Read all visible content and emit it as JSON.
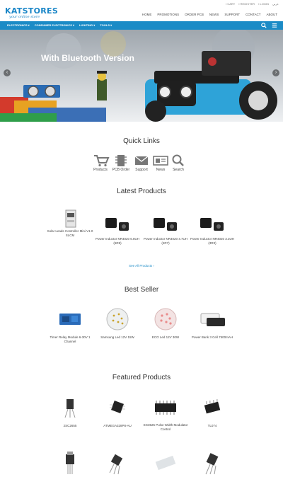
{
  "header": {
    "brand": "KATSTORES",
    "tagline": "your online store",
    "util_links": [
      "CART",
      "REGISTER",
      "LOGIN",
      "عربي"
    ],
    "nav": [
      "HOME",
      "PROMOTIONS",
      "ORDER PCB",
      "NEWS",
      "SUPPORT",
      "CONTACT",
      "ABOUT"
    ]
  },
  "categories": [
    "ELECTRONICS",
    "CONSUMER ELECTRONICS",
    "LIGHTING",
    "TOOLS"
  ],
  "hero": {
    "title": "With Bluetooth Version"
  },
  "quick_links": {
    "title": "Quick Links",
    "items": [
      "Products",
      "PCB Order",
      "Support",
      "News",
      "Search"
    ]
  },
  "latest": {
    "title": "Latest Products",
    "items": [
      "Solar Leads Controller Mini V1.0 SLCM",
      "Power Inductor NR4020 6.8UH (6R8)",
      "Power Inductor NR4020 4.7UH (4R7)",
      "Power Inductor NR4020 3.3UH (3R3)"
    ],
    "see_all": "See All Products"
  },
  "best_seller": {
    "title": "Best Seller",
    "items": [
      "Timer Relay Module 6-30V 1 Channel",
      "Samsung Led 12V 15W",
      "ECO Led 12V 30W",
      "Power Bank 3 Cell 7500mAH"
    ]
  },
  "featured": {
    "title": "Featured Products",
    "items": [
      "2SC2655",
      "ATMEGA328P8-AU",
      "SG3525 Pulse Width Modulator Control",
      "TL074"
    ]
  },
  "colors": {
    "accent": "#1b8bc6",
    "brand": "#1a86c7"
  }
}
